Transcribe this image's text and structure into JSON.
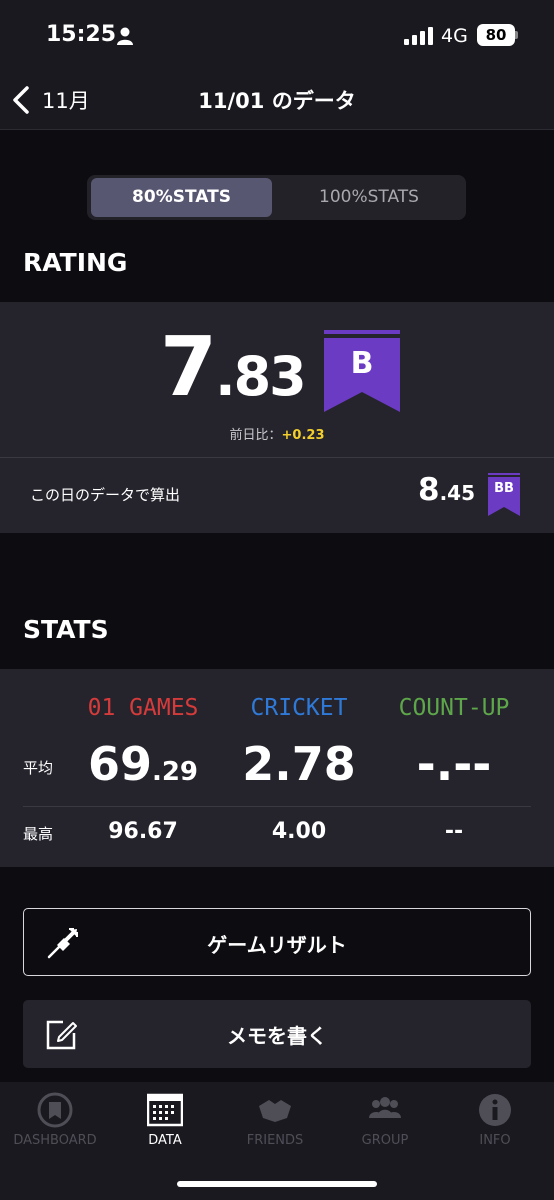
{
  "status_bar": {
    "time": "15:25",
    "network": "4G",
    "battery": "80"
  },
  "nav": {
    "back_label": "11月",
    "title": "11/01 のデータ"
  },
  "segments": {
    "active": "80%STATS",
    "inactive": "100%STATS"
  },
  "rating": {
    "section_title": "RATING",
    "value_int": "7",
    "value_dec": ".83",
    "class_flag": "B",
    "diff_label": "前日比：",
    "diff_value": "+0.23",
    "day_label": "この日のデータで算出",
    "day_value_int": "8",
    "day_value_dec": ".45",
    "day_flag": "BB",
    "flag_color": "#6c3bc4"
  },
  "stats": {
    "section_title": "STATS",
    "columns": [
      {
        "name": "01 GAMES",
        "color": "#d63b3b",
        "avg_int": "69",
        "avg_dec": ".29",
        "best": "96.67"
      },
      {
        "name": "CRICKET",
        "color": "#2f7ad8",
        "avg_int": "2.78",
        "avg_dec": "",
        "best": "4.00"
      },
      {
        "name": "COUNT-UP",
        "color": "#5ea64a",
        "avg_int": "-.--",
        "avg_dec": "",
        "best": "--"
      }
    ],
    "avg_label": "平均",
    "best_label": "最高"
  },
  "buttons": {
    "game_result": "ゲームリザルト",
    "write_memo": "メモを書く"
  },
  "tabs": [
    {
      "label": "DASHBOARD",
      "icon": "dashboard-icon",
      "active": false
    },
    {
      "label": "DATA",
      "icon": "data-icon",
      "active": true
    },
    {
      "label": "FRIENDS",
      "icon": "friends-icon",
      "active": false
    },
    {
      "label": "GROUP",
      "icon": "group-icon",
      "active": false
    },
    {
      "label": "INFO",
      "icon": "info-icon",
      "active": false
    }
  ]
}
